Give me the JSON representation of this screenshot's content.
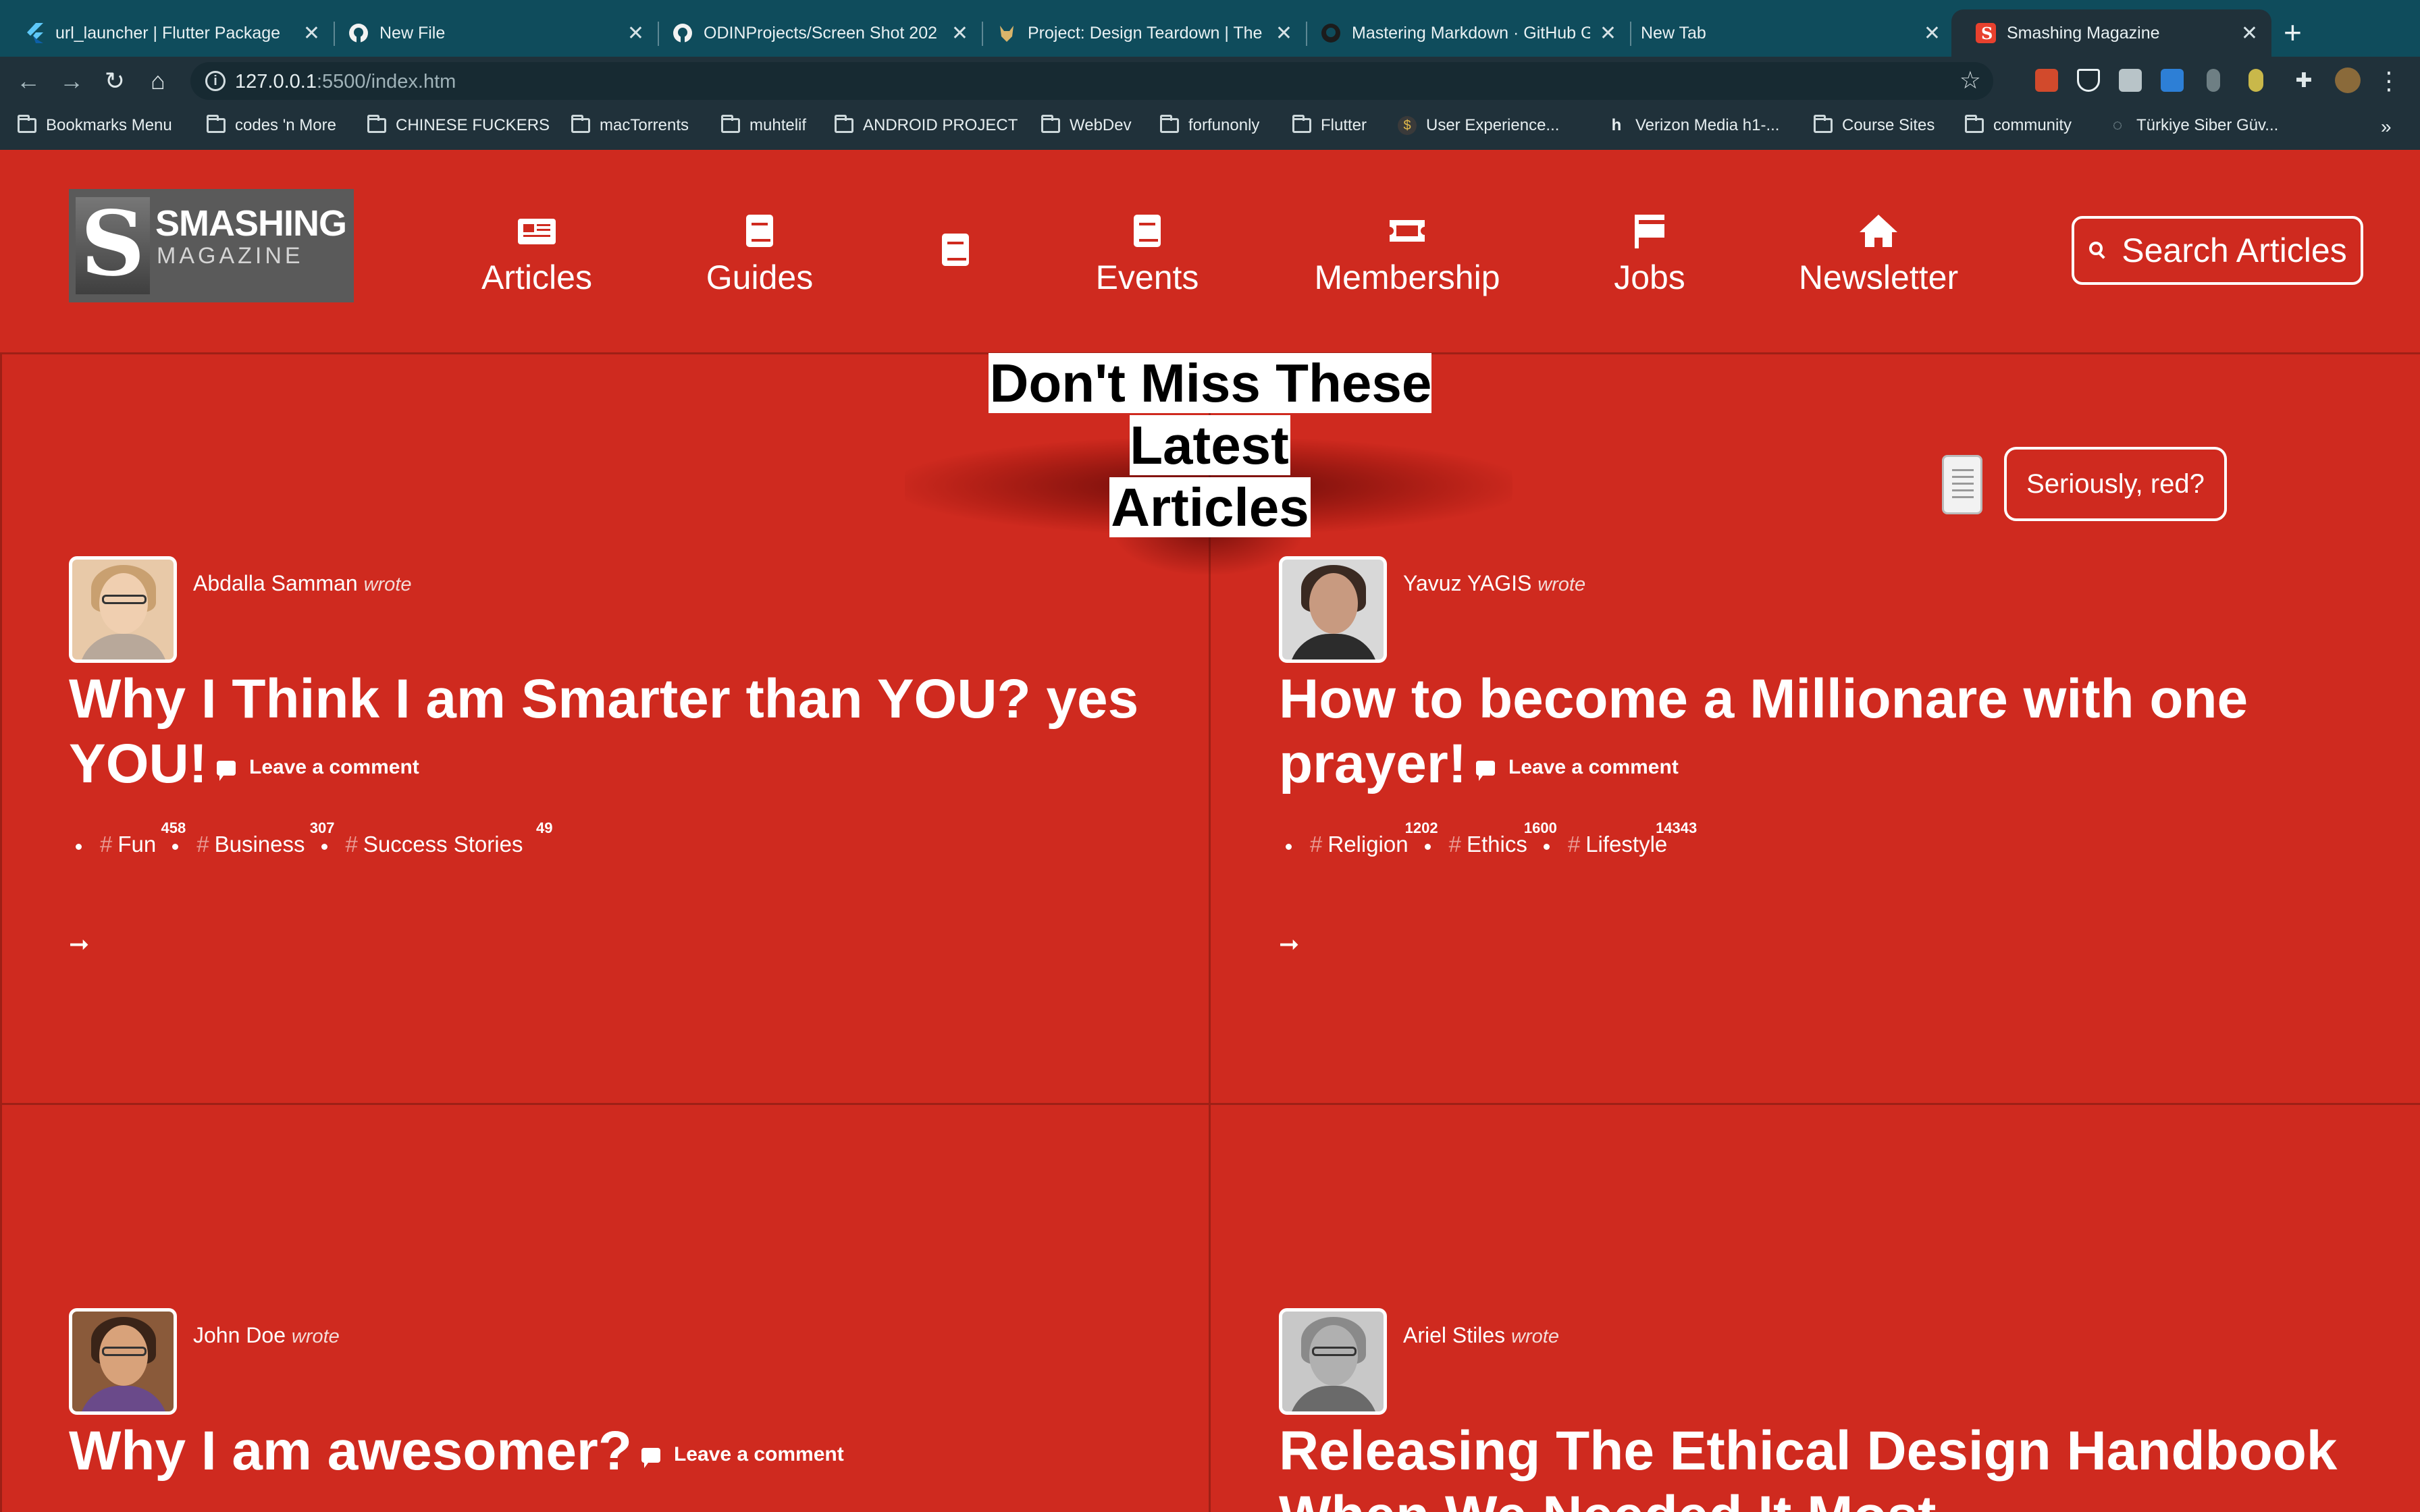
{
  "browser": {
    "tabs": [
      {
        "title": "url_launcher | Flutter Package",
        "icon": "flutter-icon"
      },
      {
        "title": "New File",
        "icon": "github-icon"
      },
      {
        "title": "ODINProjects/Screen Shot 202",
        "icon": "github-icon"
      },
      {
        "title": "Project: Design Teardown | The",
        "icon": "odin-icon"
      },
      {
        "title": "Mastering Markdown · GitHub G",
        "icon": "github-icon"
      },
      {
        "title": "New Tab",
        "icon": ""
      },
      {
        "title": "Smashing Magazine",
        "icon": "smashing-icon"
      }
    ],
    "url_host": "127.0.0.1",
    "url_path": ":5500/index.htm",
    "bookmarks": [
      {
        "label": "Bookmarks Menu",
        "icon": "folder-icon"
      },
      {
        "label": "codes 'n More",
        "icon": "folder-icon"
      },
      {
        "label": "CHINESE FUCKERS",
        "icon": "folder-icon"
      },
      {
        "label": "macTorrents",
        "icon": "folder-icon"
      },
      {
        "label": "muhtelif",
        "icon": "folder-icon"
      },
      {
        "label": "ANDROID PROJECT",
        "icon": "folder-icon"
      },
      {
        "label": "WebDev",
        "icon": "folder-icon"
      },
      {
        "label": "forfunonly",
        "icon": "folder-icon"
      },
      {
        "label": "Flutter",
        "icon": "folder-icon"
      },
      {
        "label": "User Experience...",
        "icon": "site-icon"
      },
      {
        "label": "Verizon Media h1-...",
        "icon": "h1-icon"
      },
      {
        "label": "Course Sites",
        "icon": "folder-icon"
      },
      {
        "label": "community",
        "icon": "folder-icon"
      },
      {
        "label": "Türkiye Siber Güv...",
        "icon": "spinner-icon"
      }
    ],
    "overflow": "»"
  },
  "site": {
    "logo_word1": "SMASHING",
    "logo_word2": "MAGAZINE",
    "logo_letter": "S",
    "nav": [
      {
        "label": "Articles",
        "icon": "newspaper-icon"
      },
      {
        "label": "Guides",
        "icon": "book-icon"
      },
      {
        "label": "",
        "icon": "book-icon"
      },
      {
        "label": "Events",
        "icon": "book-icon"
      },
      {
        "label": "Membership",
        "icon": "ticket-icon"
      },
      {
        "label": "Jobs",
        "icon": "flag-icon"
      },
      {
        "label": "Newsletter",
        "icon": "home-icon"
      }
    ],
    "search_label": "Search Articles",
    "latest_line1": "Don't Miss These Latest",
    "latest_line2": "Articles",
    "red_button": "Seriously, red?",
    "wrote": "wrote",
    "comment_label": "Leave a comment",
    "arrow": "➞",
    "articles": [
      {
        "author": "Abdalla Samman",
        "title": "Why I Think I am Smarter than YOU? yes YOU!",
        "tags": [
          {
            "name": "Fun",
            "count": "458"
          },
          {
            "name": "Business",
            "count": "307"
          },
          {
            "name": "Success Stories",
            "count": "49"
          }
        ]
      },
      {
        "author": "Yavuz YAGIS",
        "title": "How to become a Millionare with one prayer!",
        "tags": [
          {
            "name": "Religion",
            "count": "1202"
          },
          {
            "name": "Ethics",
            "count": "1600"
          },
          {
            "name": "Lifestyle",
            "count": "14343"
          }
        ]
      },
      {
        "author": "John Doe",
        "title": "Why I am awesomer?",
        "tags": []
      },
      {
        "author": "Ariel Stiles",
        "title": "Releasing The Ethical Design Handbook When We Needed It Most",
        "tags": []
      }
    ]
  },
  "colors": {
    "page_bg": "#cf2a1f",
    "tabstrip": "#0f4c5c",
    "toolbar": "#20313a"
  }
}
